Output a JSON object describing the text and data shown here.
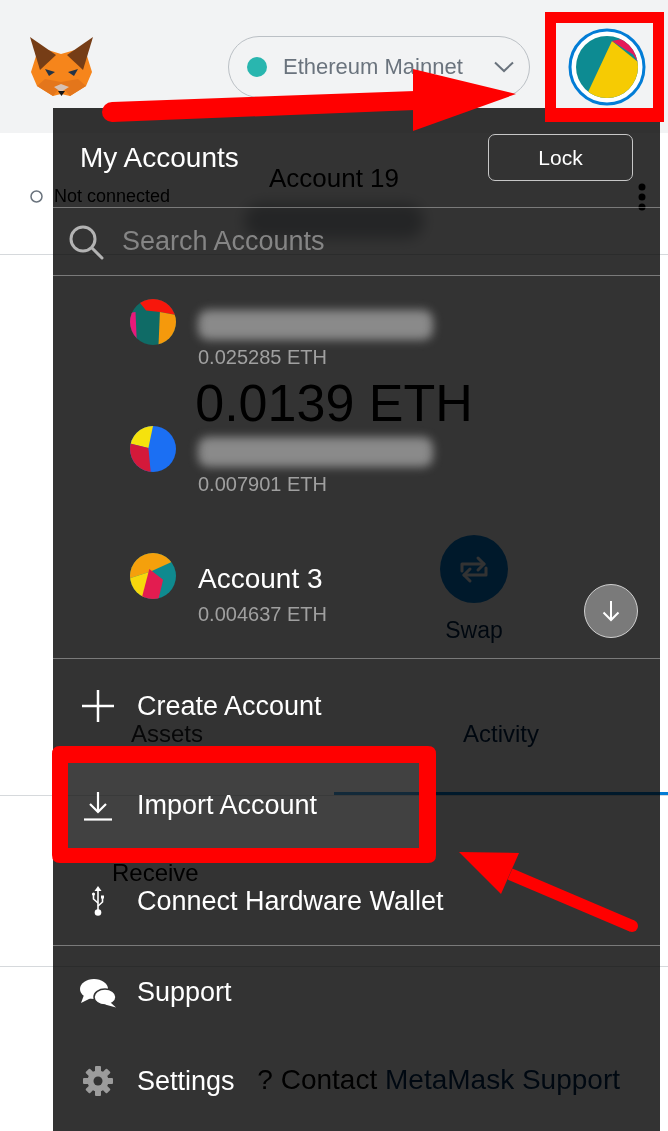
{
  "header": {
    "network": "Ethereum Mainnet"
  },
  "account_bar": {
    "status": "Not connected",
    "name": "Account 19",
    "address_redacted": true
  },
  "balance": "0.0139 ETH",
  "actions": [
    {
      "kind": "swap",
      "label": "Swap"
    }
  ],
  "tabs": [
    {
      "label": "Assets",
      "selected": false
    },
    {
      "label": "Activity",
      "selected": true
    }
  ],
  "activity": [
    {
      "title": "Receive"
    }
  ],
  "help": {
    "text": "? Contact",
    "link": "MetaMask Support"
  },
  "account_menu": {
    "title": "My Accounts",
    "lock": "Lock",
    "search": {
      "placeholder": "Search Accounts"
    },
    "accounts": [
      {
        "redacted": true,
        "balance": "0.025285 ETH"
      },
      {
        "redacted": true,
        "balance": "0.007901 ETH"
      },
      {
        "redacted": false,
        "name": "Account 3",
        "balance": "0.004637 ETH"
      }
    ],
    "sections": [
      {
        "items": [
          {
            "kind": "create",
            "label": "Create Account",
            "highlighted": false
          },
          {
            "kind": "import",
            "label": "Import Account",
            "highlighted": true
          },
          {
            "kind": "hardware",
            "label": "Connect Hardware Wallet",
            "highlighted": false
          }
        ]
      },
      {
        "items": [
          {
            "kind": "support",
            "label": "Support",
            "highlighted": false
          },
          {
            "kind": "settings",
            "label": "Settings",
            "highlighted": false
          }
        ]
      }
    ]
  }
}
